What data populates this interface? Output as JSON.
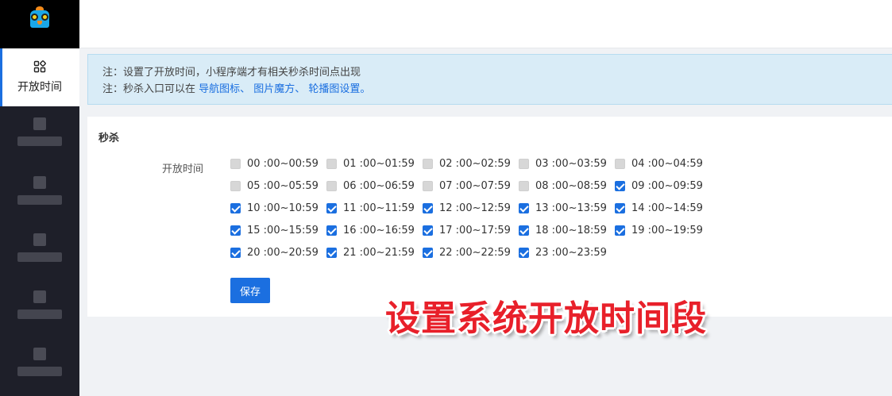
{
  "nav": {
    "active_label": "开放时间"
  },
  "notice": {
    "line1": "注：设置了开放时间，小程序端才有相关秒杀时间点出现",
    "line2_prefix": "注：秒杀入口可以在",
    "line2_links": "导航图标、 图片魔方、 轮播图设置。"
  },
  "section": {
    "title": "秒杀",
    "field_label": "开放时间",
    "save_label": "保存"
  },
  "slots": [
    {
      "label": "00 :00~00:59",
      "checked": false
    },
    {
      "label": "01 :00~01:59",
      "checked": false
    },
    {
      "label": "02 :00~02:59",
      "checked": false
    },
    {
      "label": "03 :00~03:59",
      "checked": false
    },
    {
      "label": "04 :00~04:59",
      "checked": false
    },
    {
      "label": "05 :00~05:59",
      "checked": false
    },
    {
      "label": "06 :00~06:59",
      "checked": false
    },
    {
      "label": "07 :00~07:59",
      "checked": false
    },
    {
      "label": "08 :00~08:59",
      "checked": false
    },
    {
      "label": "09 :00~09:59",
      "checked": true
    },
    {
      "label": "10 :00~10:59",
      "checked": true
    },
    {
      "label": "11 :00~11:59",
      "checked": true
    },
    {
      "label": "12 :00~12:59",
      "checked": true
    },
    {
      "label": "13 :00~13:59",
      "checked": true
    },
    {
      "label": "14 :00~14:59",
      "checked": true
    },
    {
      "label": "15 :00~15:59",
      "checked": true
    },
    {
      "label": "16 :00~16:59",
      "checked": true
    },
    {
      "label": "17 :00~17:59",
      "checked": true
    },
    {
      "label": "18 :00~18:59",
      "checked": true
    },
    {
      "label": "19 :00~19:59",
      "checked": true
    },
    {
      "label": "20 :00~20:59",
      "checked": true
    },
    {
      "label": "21 :00~21:59",
      "checked": true
    },
    {
      "label": "22 :00~22:59",
      "checked": true
    },
    {
      "label": "23 :00~23:59",
      "checked": true
    }
  ],
  "overlay_caption": "设置系统开放时间段",
  "colors": {
    "accent": "#1b6fe0",
    "sidebar": "#1e1f29",
    "notice_bg": "#d9ecf7",
    "caption": "#e8202a"
  }
}
